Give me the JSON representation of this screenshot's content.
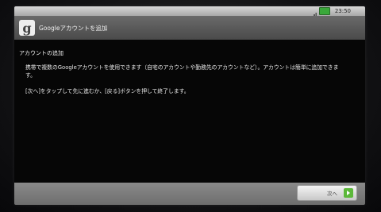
{
  "status_bar": {
    "time": "23:50",
    "battery_color": "#3aa83a",
    "icons": [
      "signal-icon",
      "battery-icon"
    ]
  },
  "title_bar": {
    "icon_glyph": "g",
    "title": "Googleアカウントを追加"
  },
  "content": {
    "heading": "アカウントの追加",
    "paragraph1": "携帯で複数のGoogleアカウントを使用できます（自宅のアカウントや勤務先のアカウントなど）。アカウントは簡単に追加できます。",
    "paragraph2": "[次へ]をタップして先に進むか、[戻る]ボタンを押して終了します。"
  },
  "footer": {
    "next_label": "次へ",
    "next_icon": "arrow-right-icon",
    "accent_color": "#5cb83a"
  }
}
